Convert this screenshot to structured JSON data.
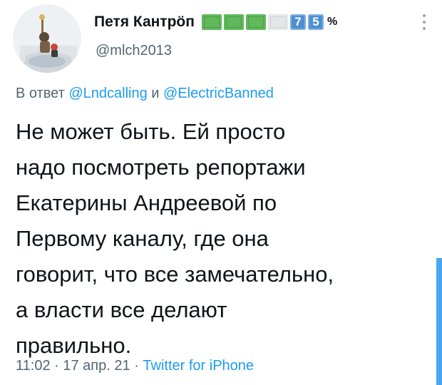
{
  "author": {
    "display_name": "Петя Кантрöп",
    "emoji_digits": [
      "7",
      "5"
    ],
    "percent_sign": "%",
    "handle": "@mlch2013",
    "battery_level": 0.75,
    "avatar_icon": "avatar-photo-icon"
  },
  "reply": {
    "prefix": "В ответ",
    "mention_1": "@Lndcalling",
    "conjunction": "и",
    "mention_2": "@ElectricBanned"
  },
  "tweet": {
    "lines": [
      "Не может быть. Ей просто",
      "надо посмотреть репортажи",
      "Екатерины Андреевой по",
      "Первому каналу, где она",
      "говорит, что все замечательно,",
      "а власти все делают",
      "правильно."
    ]
  },
  "meta": {
    "time": "11:02",
    "separator": "·",
    "date": "17 апр. 21",
    "source": "Twitter for iPhone"
  },
  "colors": {
    "link": "#1d9bf0",
    "secondary_text": "#536471",
    "battery_green": "#5fb85a",
    "keycap_blue": "#4d8fd1"
  }
}
